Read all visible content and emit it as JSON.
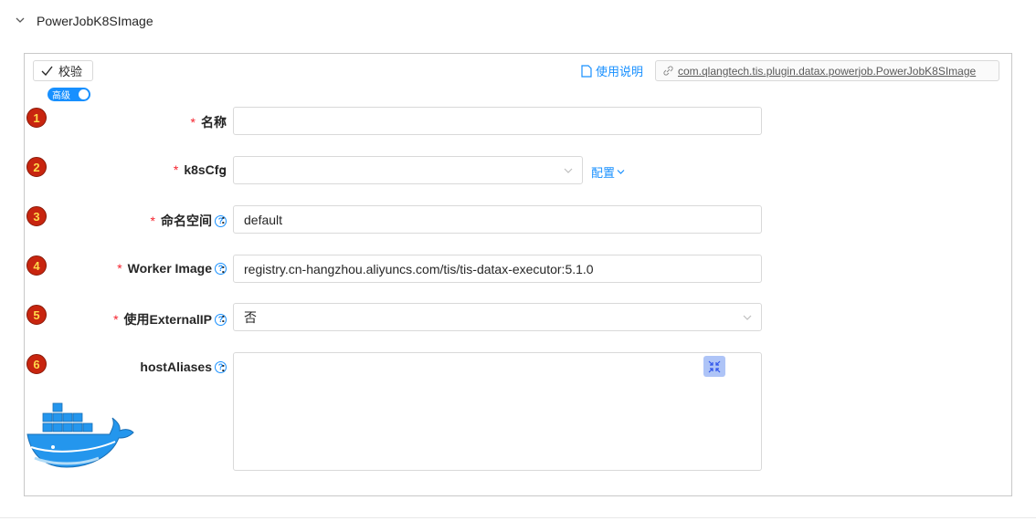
{
  "panel": {
    "title": "PowerJobK8SImage"
  },
  "toolbar": {
    "validate_label": "校验",
    "advanced_toggle_label": "高级",
    "doc_link_label": "使用说明",
    "impl_class": "com.qlangtech.tis.plugin.datax.powerjob.PowerJobK8SImage"
  },
  "fields": [
    {
      "index": "1",
      "label": "名称",
      "required": "*",
      "value": ""
    },
    {
      "index": "2",
      "label": "k8sCfg",
      "required": "*",
      "value": "",
      "config_label": "配置"
    },
    {
      "index": "3",
      "label": "命名空间",
      "required": "*",
      "value": "default"
    },
    {
      "index": "4",
      "label": "Worker Image",
      "required": "*",
      "value": "registry.cn-hangzhou.aliyuncs.com/tis/tis-datax-executor:5.1.0"
    },
    {
      "index": "5",
      "label": "使用ExternalIP",
      "required": "*",
      "value": "否"
    },
    {
      "index": "6",
      "label": "hostAliases",
      "required": "",
      "value": ""
    }
  ],
  "colors": {
    "accent": "#1890ff",
    "required": "#f5222d",
    "badge": "#c8250f"
  },
  "icons": [
    "chevron-down-icon",
    "check-icon",
    "document-icon",
    "link-icon",
    "help-icon",
    "expand-icon",
    "docker-whale-icon"
  ]
}
